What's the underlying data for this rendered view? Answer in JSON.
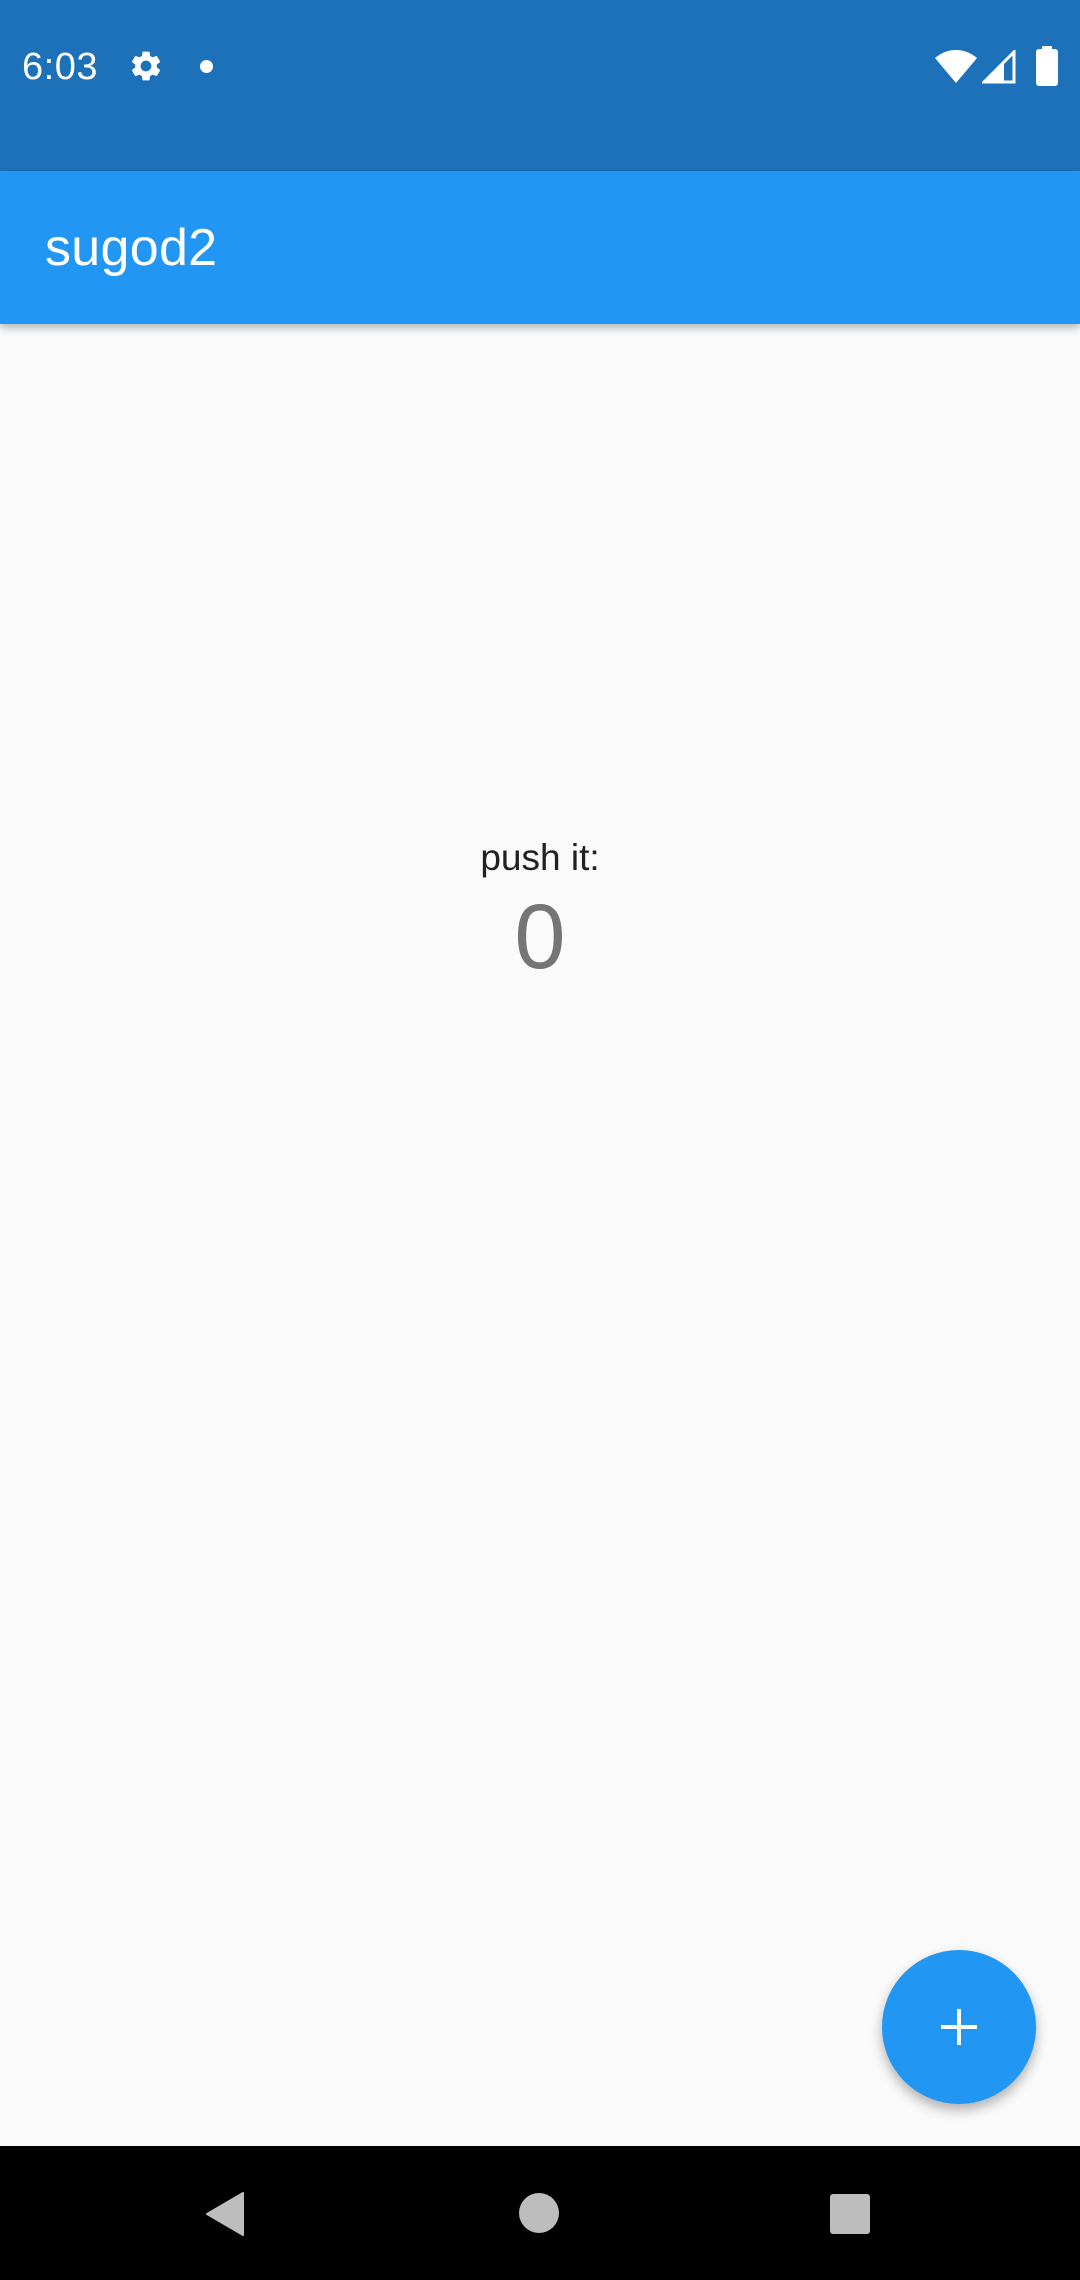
{
  "status_bar": {
    "time": "6:03",
    "icons": [
      "gear-icon",
      "notification-dot-icon",
      "wifi-icon",
      "cell-signal-icon",
      "battery-icon"
    ]
  },
  "app_bar": {
    "title": "sugod2"
  },
  "main": {
    "label": "push it:",
    "counter": "0"
  },
  "fab": {
    "icon": "plus-icon"
  },
  "nav_bar": {
    "icons": [
      "back-icon",
      "home-icon",
      "recents-icon"
    ]
  },
  "colors": {
    "status_bar": "#1c71b9",
    "app_bar": "#2196f3",
    "fab": "#2196f3",
    "background": "#fafafa",
    "nav_bar": "#000000"
  }
}
